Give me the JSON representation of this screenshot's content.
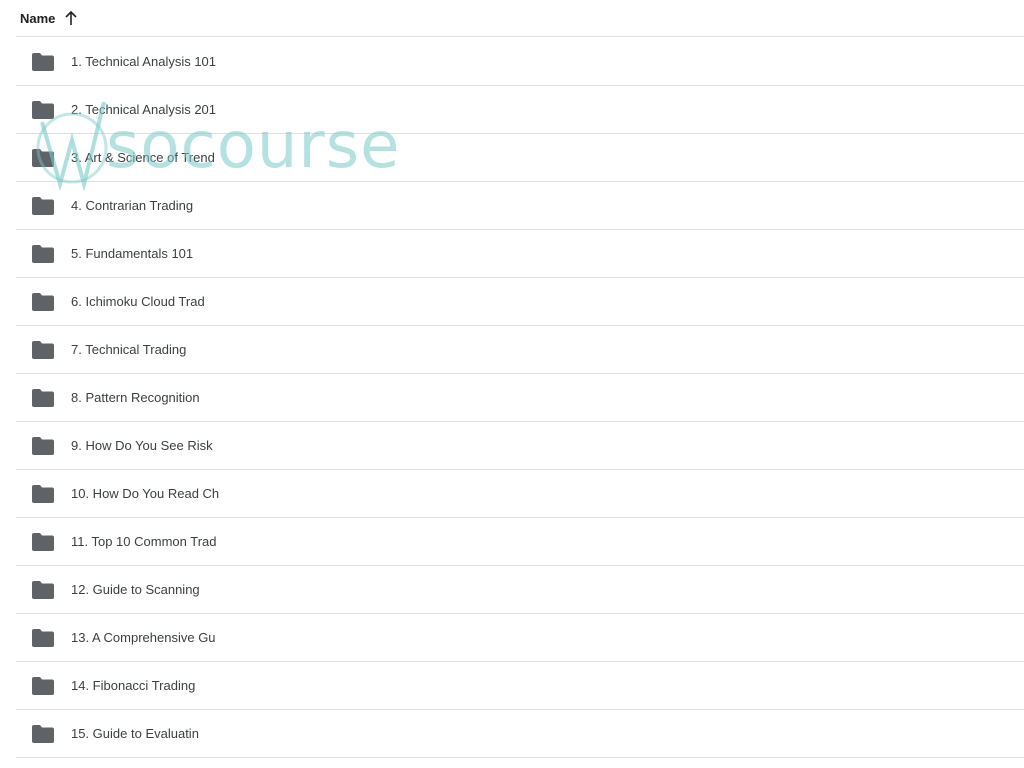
{
  "header": {
    "name_label": "Name",
    "sort_icon": "arrow-up-icon"
  },
  "folder_icon": "folder-icon",
  "folders": [
    {
      "label": "1. Technical Analysis 101"
    },
    {
      "label": "2. Technical Analysis 201"
    },
    {
      "label": "3. Art & Science of Trend"
    },
    {
      "label": "4. Contrarian Trading"
    },
    {
      "label": "5. Fundamentals 101"
    },
    {
      "label": "6. Ichimoku Cloud Trad"
    },
    {
      "label": "7. Technical Trading"
    },
    {
      "label": "8. Pattern Recognition"
    },
    {
      "label": "9. How Do You See Risk"
    },
    {
      "label": "10. How Do You Read Ch"
    },
    {
      "label": "11. Top 10 Common Trad"
    },
    {
      "label": "12. Guide to Scanning"
    },
    {
      "label": "13. A Comprehensive Gu"
    },
    {
      "label": "14. Fibonacci Trading"
    },
    {
      "label": "15. Guide to Evaluatin"
    }
  ],
  "watermark": {
    "text": "socourse"
  },
  "colors": {
    "folder": "#5f6368",
    "divider": "#e0e0e0",
    "watermark": "#78c8c8"
  }
}
